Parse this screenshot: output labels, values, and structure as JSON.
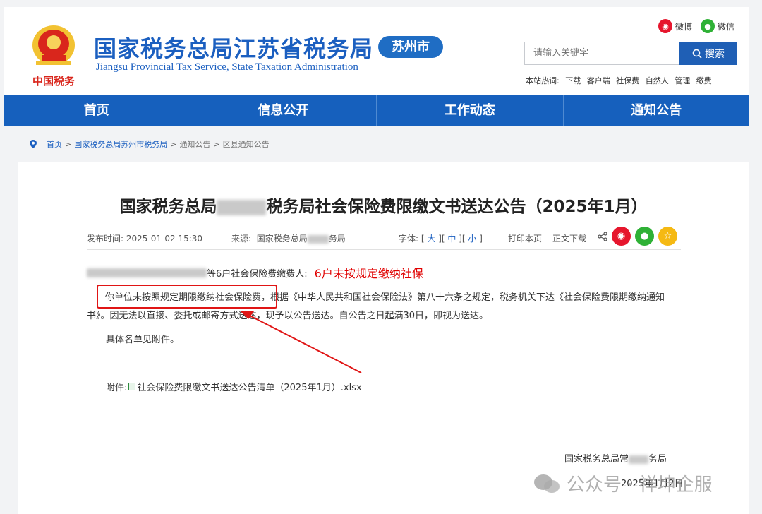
{
  "header": {
    "site_name": "国家税务总局江苏省税务局",
    "site_name_en": "Jiangsu Provincial Tax Service, State Taxation Administration",
    "city_badge": "苏州市",
    "emblem_text": "中国税务",
    "social": {
      "weibo": "微博",
      "wechat": "微信"
    },
    "search": {
      "placeholder": "请输入关键字",
      "button_label": "搜索"
    },
    "hot": {
      "label": "本站热词:",
      "items": [
        "下载",
        "客户端",
        "社保费",
        "自然人",
        "管理",
        "缴费"
      ]
    }
  },
  "nav": {
    "items": [
      "首页",
      "信息公开",
      "工作动态",
      "通知公告"
    ]
  },
  "breadcrumb": {
    "home": "首页",
    "sep": ">",
    "items": [
      "国家税务总局苏州市税务局",
      "通知公告",
      "区县通知公告"
    ]
  },
  "article": {
    "title_prefix": "国家税务总局",
    "title_suffix": "税务局社会保险费限缴文书送达公告（2025年1月）",
    "meta": {
      "publish_label": "发布时间:",
      "publish_time": "2025-01-02 15:30",
      "source_label": "来源:",
      "source_prefix": "国家税务总局",
      "source_suffix": "务局",
      "font_label": "字体:",
      "size_large": "大",
      "size_medium": "中",
      "size_small": "小",
      "print": "打印本页",
      "download": "正文下载"
    },
    "recipient_text": "等6户社会保险费缴费人:",
    "annotation": "6户未按规定缴纳社保",
    "para1": "你单位未按照规定期限缴纳社会保险费，根据《中华人民共和国社会保险法》第八十六条之规定，税务机关下达《社会保险费限期缴纳通知书》。因无法以直接、委托或邮寄方式送达，现予以公告送达。自公告之日起满30日，即视为送达。",
    "para2": "具体名单见附件。",
    "attachment_label": "附件:",
    "attachment_name": "社会保险费限缴文书送达公告清单（2025年1月）.xlsx",
    "signature_prefix": "国家税务总局常",
    "signature_suffix": "务局",
    "date": "2025年1月2日"
  },
  "watermark": "公众号 · 祥坤企服",
  "colors": {
    "brand_blue": "#1660bd",
    "title_blue": "#1b5fc0",
    "alert_red": "#e00000"
  }
}
